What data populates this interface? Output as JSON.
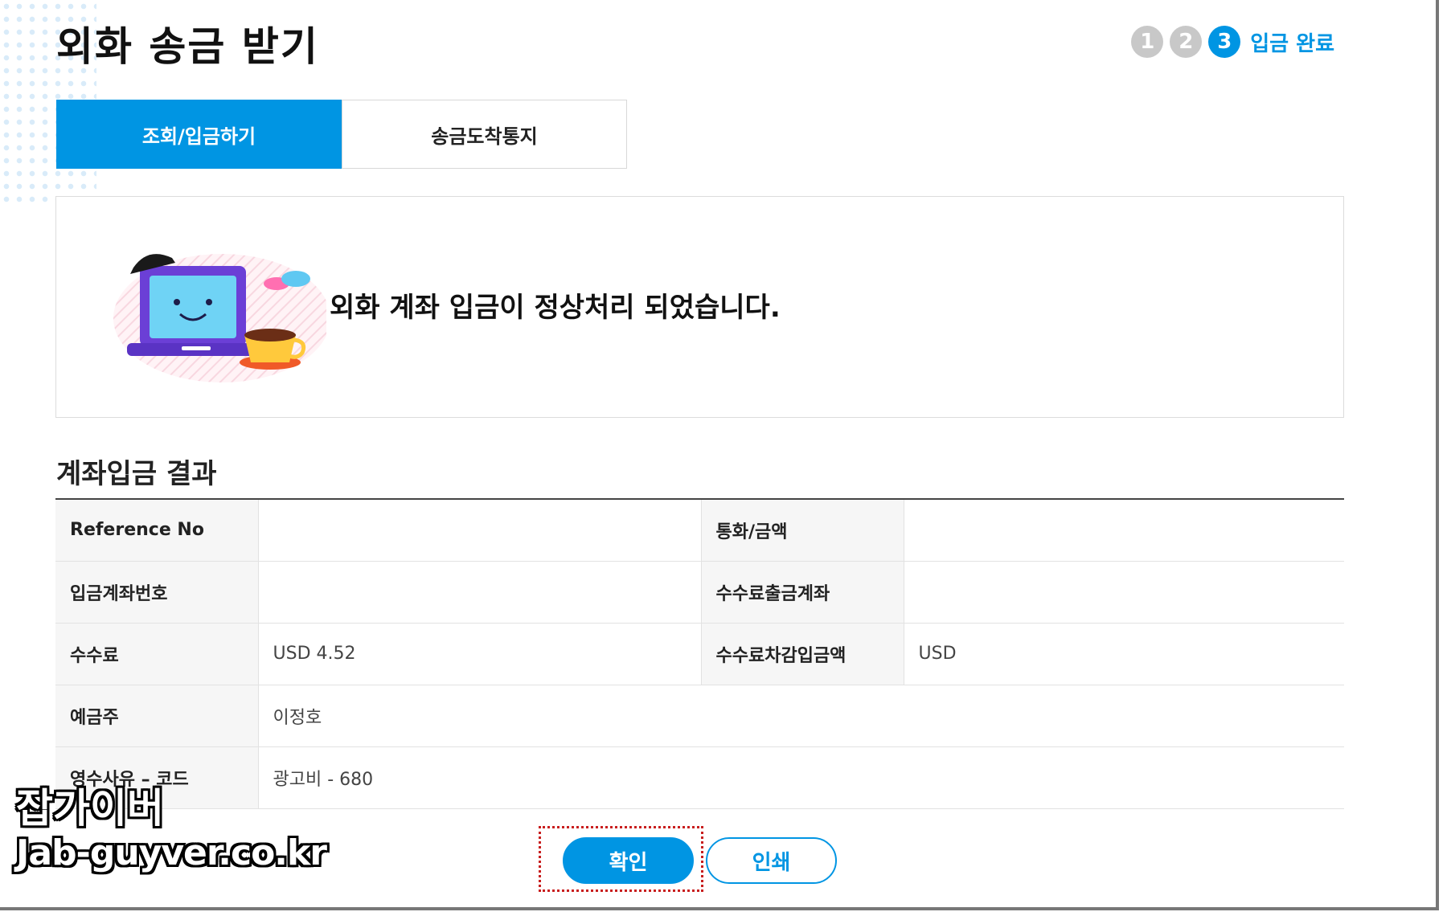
{
  "page": {
    "title": "외화 송금 받기"
  },
  "steps": {
    "items": [
      "1",
      "2",
      "3"
    ],
    "active_label": "입금 완료"
  },
  "tabs": [
    {
      "label": "조회/입금하기",
      "active": true
    },
    {
      "label": "송금도착통지",
      "active": false
    }
  ],
  "message": {
    "text": "외화 계좌 입금이 정상처리 되었습니다."
  },
  "result": {
    "title": "계좌입금 결과",
    "rows": [
      {
        "label1": "Reference No",
        "value1": "",
        "label2": "통화/금액",
        "value2": ""
      },
      {
        "label1": "입금계좌번호",
        "value1": "",
        "label2": "수수료출금계좌",
        "value2": ""
      },
      {
        "label1": "수수료",
        "value1": "USD 4.52",
        "label2": "수수료차감입금액",
        "value2": "USD"
      },
      {
        "label1": "예금주",
        "value1": "이정호"
      },
      {
        "label1": "영수사유 – 코드",
        "value1": "광고비 - 680"
      }
    ]
  },
  "buttons": {
    "confirm": "확인",
    "print": "인쇄"
  },
  "watermark": {
    "name": "잡가이버",
    "url": "Jab-guyver.co.kr"
  },
  "colors": {
    "accent": "#0095e3",
    "highlight": "#c81e1e"
  }
}
